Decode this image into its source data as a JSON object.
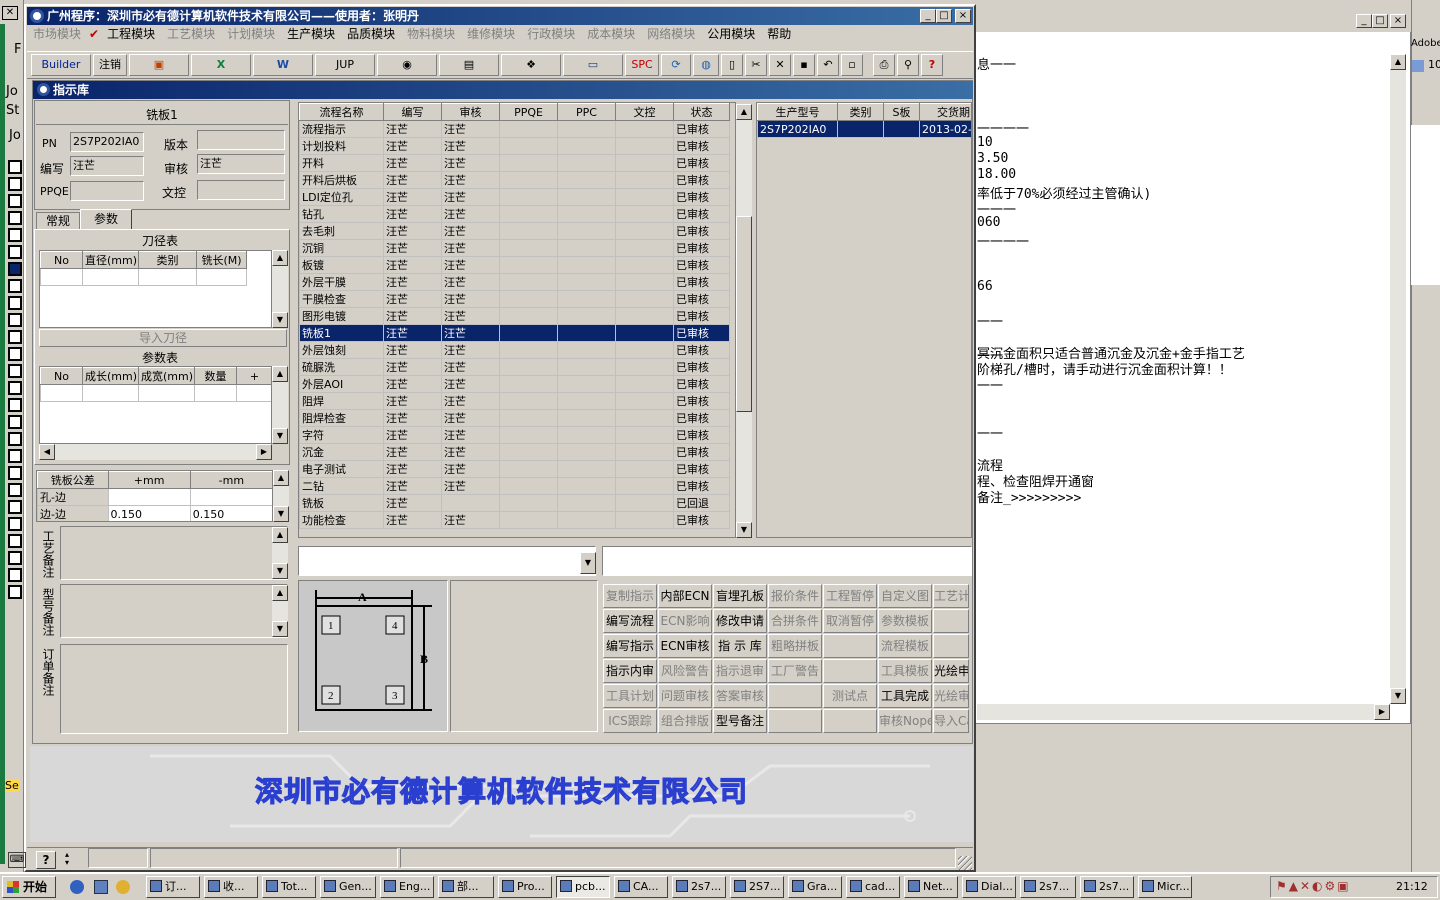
{
  "main_title": "广州程序：深圳市必有德计算机软件技术有限公司——使用者：张明丹",
  "menu": [
    {
      "label": "市场模块",
      "enabled": false
    },
    {
      "label": "工程模块",
      "enabled": true,
      "checked": true
    },
    {
      "label": "工艺模块",
      "enabled": false
    },
    {
      "label": "计划模块",
      "enabled": false
    },
    {
      "label": "生产模块",
      "enabled": true
    },
    {
      "label": "品质模块",
      "enabled": true
    },
    {
      "label": "物料模块",
      "enabled": false
    },
    {
      "label": "维修模块",
      "enabled": false
    },
    {
      "label": "行政模块",
      "enabled": false
    },
    {
      "label": "成本模块",
      "enabled": false
    },
    {
      "label": "网络模块",
      "enabled": false
    },
    {
      "label": "公用模块",
      "enabled": true
    },
    {
      "label": "帮助",
      "enabled": true
    }
  ],
  "toolbar": {
    "builder": "Builder",
    "logout": "注销",
    "jup": "JUP",
    "spc": "SPC"
  },
  "child_title": "指示库",
  "left": {
    "section": "铣板1",
    "pn_label": "PN",
    "pn_value": "2S7P202IA0",
    "version_label": "版本",
    "version_value": "",
    "writer_label": "编写",
    "writer_value": "汪芒",
    "reviewer_label": "审核",
    "reviewer_value": "汪芒",
    "ppqe_label": "PPQE",
    "ppqe_value": "",
    "doc_label": "文控",
    "doc_value": "",
    "tab1": "常规",
    "tab2": "参数",
    "tool_table_title": "刀径表",
    "tool_headers": [
      "No",
      "直径(mm)",
      "类别",
      "铣长(M)"
    ],
    "import_btn": "导入刀径",
    "param_title": "参数表",
    "param_headers": [
      "No",
      "成长(mm)",
      "成宽(mm)",
      "数量",
      "+"
    ],
    "tol_headers": [
      "铣板公差",
      "+mm",
      "-mm"
    ],
    "tol_rows": [
      [
        "孔-边",
        "",
        ""
      ],
      [
        "边-边",
        "0.150",
        "0.150"
      ]
    ],
    "remark1": "工艺备注",
    "remark2": "型号备注",
    "remark3": "订单备注"
  },
  "flow": {
    "headers": [
      "流程名称",
      "编写",
      "审核",
      "PPQE",
      "PPC",
      "文控",
      "状态"
    ],
    "rows": [
      [
        "流程指示",
        "汪芒",
        "汪芒",
        "",
        "",
        "",
        "已审核"
      ],
      [
        "计划投料",
        "汪芒",
        "汪芒",
        "",
        "",
        "",
        "已审核"
      ],
      [
        "开料",
        "汪芒",
        "汪芒",
        "",
        "",
        "",
        "已审核"
      ],
      [
        "开料后烘板",
        "汪芒",
        "汪芒",
        "",
        "",
        "",
        "已审核"
      ],
      [
        "LDI定位孔",
        "汪芒",
        "汪芒",
        "",
        "",
        "",
        "已审核"
      ],
      [
        "钻孔",
        "汪芒",
        "汪芒",
        "",
        "",
        "",
        "已审核"
      ],
      [
        "去毛刺",
        "汪芒",
        "汪芒",
        "",
        "",
        "",
        "已审核"
      ],
      [
        "沉铜",
        "汪芒",
        "汪芒",
        "",
        "",
        "",
        "已审核"
      ],
      [
        "板镀",
        "汪芒",
        "汪芒",
        "",
        "",
        "",
        "已审核"
      ],
      [
        "外层干膜",
        "汪芒",
        "汪芒",
        "",
        "",
        "",
        "已审核"
      ],
      [
        "干膜检查",
        "汪芒",
        "汪芒",
        "",
        "",
        "",
        "已审核"
      ],
      [
        "图形电镀",
        "汪芒",
        "汪芒",
        "",
        "",
        "",
        "已审核"
      ],
      [
        "铣板1",
        "汪芒",
        "汪芒",
        "",
        "",
        "",
        "已审核"
      ],
      [
        "外层蚀刻",
        "汪芒",
        "汪芒",
        "",
        "",
        "",
        "已审核"
      ],
      [
        "硫脲洗",
        "汪芒",
        "汪芒",
        "",
        "",
        "",
        "已审核"
      ],
      [
        "外层AOI",
        "汪芒",
        "汪芒",
        "",
        "",
        "",
        "已审核"
      ],
      [
        "阻焊",
        "汪芒",
        "汪芒",
        "",
        "",
        "",
        "已审核"
      ],
      [
        "阻焊检查",
        "汪芒",
        "汪芒",
        "",
        "",
        "",
        "已审核"
      ],
      [
        "字符",
        "汪芒",
        "汪芒",
        "",
        "",
        "",
        "已审核"
      ],
      [
        "沉金",
        "汪芒",
        "汪芒",
        "",
        "",
        "",
        "已审核"
      ],
      [
        "电子测试",
        "汪芒",
        "汪芒",
        "",
        "",
        "",
        "已审核"
      ],
      [
        "二钻",
        "汪芒",
        "汪芒",
        "",
        "",
        "",
        "已审核"
      ],
      [
        "铣板",
        "汪芒",
        "",
        "",
        "",
        "",
        "已回退"
      ],
      [
        "功能检查",
        "汪芒",
        "汪芒",
        "",
        "",
        "",
        "已审核"
      ]
    ],
    "selected": 12
  },
  "prod": {
    "headers": [
      "生产型号",
      "类别",
      "S板",
      "交货期"
    ],
    "row": [
      "2S7P202IA0",
      "",
      "",
      "2013-02-"
    ]
  },
  "diagram": {
    "a": "A",
    "b": "B",
    "n1": "1",
    "n2": "2",
    "n3": "3",
    "n4": "4"
  },
  "buttons": [
    [
      {
        "t": "复制指示",
        "e": false
      },
      {
        "t": "内部ECN",
        "e": true
      },
      {
        "t": "盲埋孔板",
        "e": true
      },
      {
        "t": "报价条件",
        "e": false
      },
      {
        "t": "工程暂停",
        "e": false
      },
      {
        "t": "自定义图",
        "e": false
      },
      {
        "t": "工艺计",
        "e": false
      }
    ],
    [
      {
        "t": "编写流程",
        "e": true
      },
      {
        "t": "ECN影响",
        "e": false
      },
      {
        "t": "修改申请",
        "e": true
      },
      {
        "t": "合拼条件",
        "e": false
      },
      {
        "t": "取消暂停",
        "e": false
      },
      {
        "t": "参数模板",
        "e": false
      },
      {
        "t": "",
        "e": false
      }
    ],
    [
      {
        "t": "编写指示",
        "e": true
      },
      {
        "t": "ECN审核",
        "e": true
      },
      {
        "t": "指 示 库",
        "e": true
      },
      {
        "t": "粗略拼板",
        "e": false
      },
      {
        "t": "",
        "e": false
      },
      {
        "t": "流程模板",
        "e": false
      },
      {
        "t": "",
        "e": false
      }
    ],
    [
      {
        "t": "指示内审",
        "e": true
      },
      {
        "t": "风险警告",
        "e": false
      },
      {
        "t": "指示退审",
        "e": false
      },
      {
        "t": "工厂警告",
        "e": false
      },
      {
        "t": "",
        "e": false
      },
      {
        "t": "工具模板",
        "e": false
      },
      {
        "t": "光绘申",
        "e": true
      }
    ],
    [
      {
        "t": "工具计划",
        "e": false
      },
      {
        "t": "问题审核",
        "e": false
      },
      {
        "t": "答案审核",
        "e": false
      },
      {
        "t": "",
        "e": false
      },
      {
        "t": "测试点",
        "e": false
      },
      {
        "t": "工具完成",
        "e": true
      },
      {
        "t": "光绘审",
        "e": false
      }
    ],
    [
      {
        "t": "ICS跟踪",
        "e": false
      },
      {
        "t": "组合排版",
        "e": false
      },
      {
        "t": "型号备注",
        "e": true
      },
      {
        "t": "",
        "e": false
      },
      {
        "t": "",
        "e": false
      },
      {
        "t": "审核Nope",
        "e": false
      },
      {
        "t": "导入Ca",
        "e": false
      }
    ]
  ],
  "company": "深圳市必有德计算机软件技术有限公司",
  "notes": [
    "息一一",
    "一一一一",
    "10",
    "3.50",
    "18.00",
    "率低于70%必须经过主管确认)",
    "一一一",
    "060",
    "一一一一",
    "66",
    "一一",
    "一一",
    "冥沉金面积只适合普通沉金及沉金+金手指工艺",
    "阶梯孔/槽时，请手动进行沉金面积计算！！",
    "一一",
    "一一",
    "流程",
    "程、检查阻焊开通窗",
    "备注_>>>>>>>>>"
  ],
  "right_app": {
    "label1": "Adobe",
    "label2": "10"
  },
  "left_strip": [
    "F",
    "Jo",
    "St",
    "Jo",
    "Se"
  ],
  "taskbar": {
    "start": "开始",
    "items": [
      "订...",
      "收...",
      "Tot...",
      "Gen...",
      "Eng...",
      "部...",
      "Pro...",
      "pcb...",
      "CA...",
      "2s7...",
      "2S7...",
      "Gra...",
      "cad...",
      "Net...",
      "Dial...",
      "2s7...",
      "2s7...",
      "Micr..."
    ],
    "clock": "21:12"
  }
}
